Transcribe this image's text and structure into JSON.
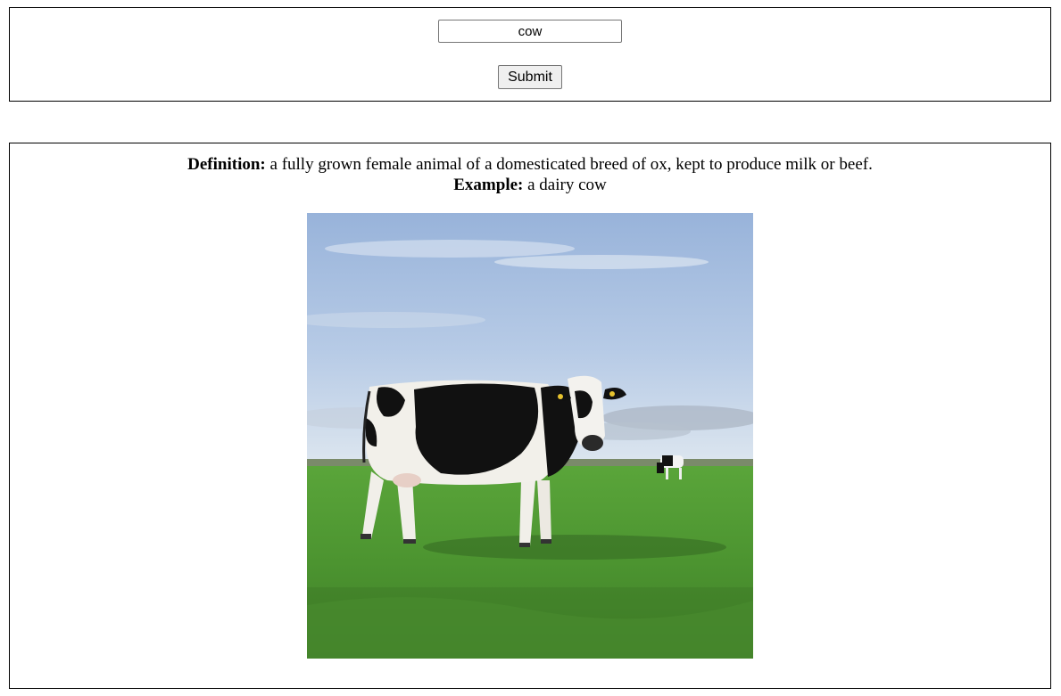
{
  "search": {
    "query": "cow",
    "submit_label": "Submit"
  },
  "result": {
    "definition_label": "Definition:",
    "definition_text": "a fully grown female animal of a domesticated breed of ox, kept to produce milk or beef.",
    "example_label": "Example:",
    "example_text": "a dairy cow",
    "image": {
      "subject": "holstein-cow-in-pasture-photo"
    }
  },
  "colors": {
    "sky_top": "#9fb9dd",
    "sky_bottom": "#d9e4f0",
    "grass": "#4f9a2e",
    "border": "#000000"
  }
}
